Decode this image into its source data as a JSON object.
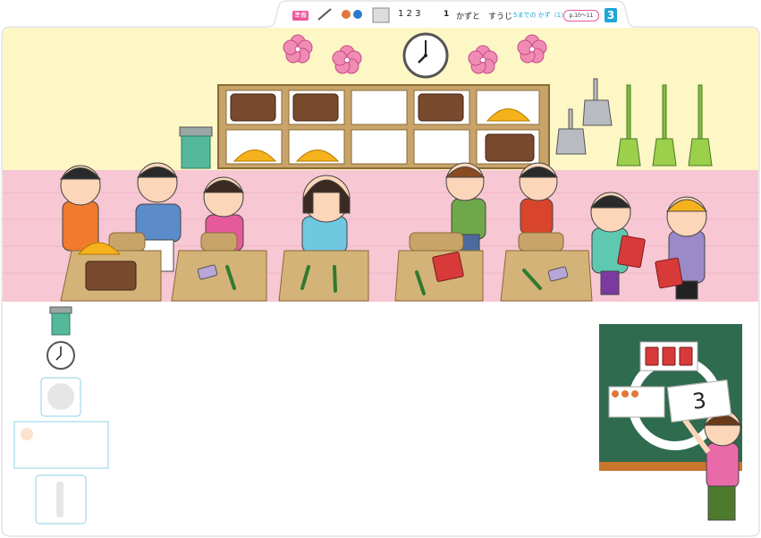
{
  "header": {
    "badge_label": "準備",
    "chapter_number": "1",
    "chapter_title": "かずと　すうじ",
    "section_title": "5までの かず（1）",
    "pages": "p.10～11",
    "lesson_number": "3"
  },
  "board": {
    "card_number": "3"
  },
  "colors": {
    "wall": "#fdf6c5",
    "floor": "#f7c7d3",
    "board": "#2f6b4f",
    "accent_pink": "#e8589a",
    "accent_blue": "#1fa5d8"
  },
  "icons": [
    "pencil-icon",
    "clock-icon",
    "trash-can-icon",
    "sakura-icon",
    "helmet-icon",
    "book-icon",
    "broom-icon",
    "dustpan-icon",
    "textbook-icon"
  ]
}
